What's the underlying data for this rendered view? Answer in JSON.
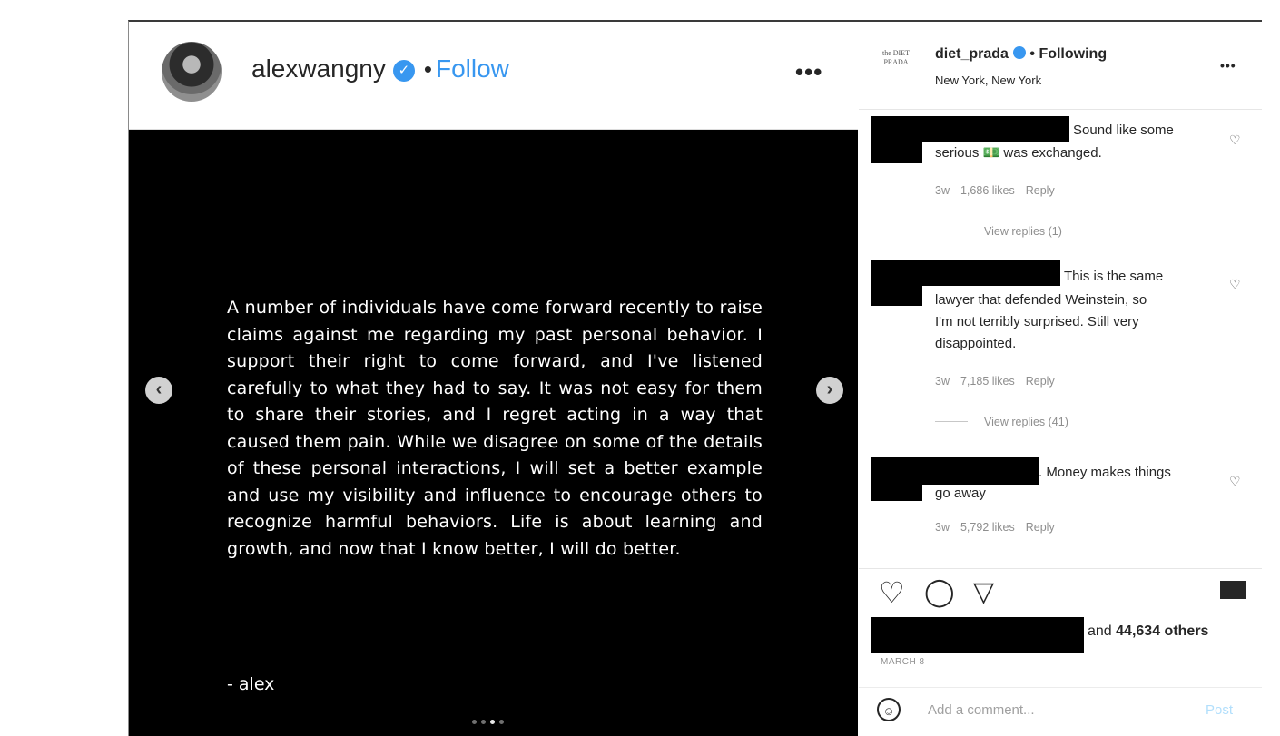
{
  "post": {
    "username": "alexwangny",
    "verified_icon": "verified-badge-icon",
    "separator": "•",
    "follow_label": "Follow",
    "more_label": "•••",
    "statement": "A number of individuals have come forward recently to raise claims against me regarding my past personal behavior. I support their right to come forward, and I've listened carefully to what they had to say. It was not easy for them to share their stories, and I regret acting in a way that caused them pain. While we disagree on some of the details of these personal interactions, I will set a better example and use my visibility and influence to encourage others to recognize harmful behaviors. Life is about learning and growth, and now that I know better, I will do better.",
    "signoff": "- alex",
    "prev_arrow": "‹",
    "next_arrow": "›",
    "carousel_total": 4,
    "carousel_active": 3
  },
  "side": {
    "avatar_text": "the DIET PRADA",
    "username": "diet_prada",
    "separator": "•",
    "following_label": "Following",
    "location": "New York, New York",
    "more_label": "•••",
    "comments": [
      {
        "text": "Sound like some serious 💵 was exchanged.",
        "text_line1": "Sound like some",
        "text_line2": "serious 💵 was exchanged.",
        "age": "3w",
        "likes": "1,686 likes",
        "reply": "Reply",
        "view_replies": "View replies (1)"
      },
      {
        "text_line1": "This is the same",
        "text_line2": "lawyer that defended Weinstein, so",
        "text_line3": "I'm not terribly surprised. Still very",
        "text_line4": "disappointed.",
        "age": "3w",
        "likes": "7,185 likes",
        "reply": "Reply",
        "view_replies": "View replies (41)"
      },
      {
        "text_line1": ". Money makes things",
        "text_line2": "go away",
        "age": "3w",
        "likes": "5,792 likes",
        "reply": "Reply"
      }
    ],
    "likes_suffix": "and",
    "likes_count": "44,634 others",
    "date": "MARCH 8",
    "comment_placeholder": "Add a comment...",
    "post_button": "Post"
  },
  "icons": {
    "heart": "♡",
    "comment": "◯",
    "share": "▽",
    "bookmark": "bookmark-icon",
    "comment_heart": "♡",
    "emoji": "☺"
  }
}
